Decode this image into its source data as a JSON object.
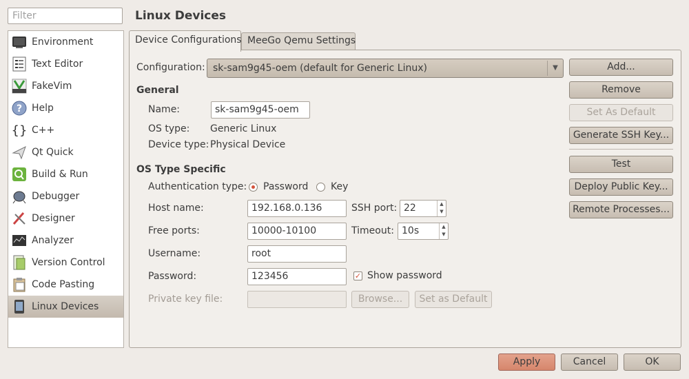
{
  "filter": {
    "placeholder": "Filter"
  },
  "sidebar": {
    "items": [
      {
        "label": "Environment",
        "icon": "monitor-icon"
      },
      {
        "label": "Text Editor",
        "icon": "text-editor-icon"
      },
      {
        "label": "FakeVim",
        "icon": "fakevim-icon"
      },
      {
        "label": "Help",
        "icon": "help-icon"
      },
      {
        "label": "C++",
        "icon": "braces-icon"
      },
      {
        "label": "Qt Quick",
        "icon": "qt-quick-icon"
      },
      {
        "label": "Build & Run",
        "icon": "build-run-icon"
      },
      {
        "label": "Debugger",
        "icon": "debugger-icon"
      },
      {
        "label": "Designer",
        "icon": "designer-icon"
      },
      {
        "label": "Analyzer",
        "icon": "analyzer-icon"
      },
      {
        "label": "Version Control",
        "icon": "version-control-icon"
      },
      {
        "label": "Code Pasting",
        "icon": "code-pasting-icon"
      },
      {
        "label": "Linux Devices",
        "icon": "linux-device-icon",
        "selected": true
      }
    ]
  },
  "page_title": "Linux Devices",
  "tabs": [
    {
      "label": "Device Configurations",
      "active": true
    },
    {
      "label": "MeeGo Qemu Settings",
      "active": false
    }
  ],
  "config": {
    "label": "Configuration:",
    "value": "sk-sam9g45-oem (default for Generic Linux)"
  },
  "general": {
    "title": "General",
    "name_label": "Name:",
    "name_value": "sk-sam9g45-oem",
    "os_type_label": "OS type:",
    "os_type_value": "Generic Linux",
    "device_type_label": "Device type:",
    "device_type_value": "Physical Device"
  },
  "os_specific": {
    "title": "OS Type Specific",
    "auth_label": "Authentication type:",
    "auth_password": "Password",
    "auth_key": "Key",
    "auth_selected": "Password",
    "host_label": "Host name:",
    "host_value": "192.168.0.136",
    "ssh_port_label": "SSH port:",
    "ssh_port_value": "22",
    "free_ports_label": "Free ports:",
    "free_ports_value": "10000-10100",
    "timeout_label": "Timeout:",
    "timeout_value": "10s",
    "username_label": "Username:",
    "username_value": "root",
    "password_label": "Password:",
    "password_value": "123456",
    "show_password_label": "Show password",
    "show_password_checked": true,
    "private_key_label": "Private key file:",
    "private_key_value": "",
    "browse_label": "Browse...",
    "set_default_label": "Set as Default"
  },
  "side_buttons": {
    "add": "Add...",
    "remove": "Remove",
    "set_as_default": "Set As Default",
    "generate_ssh_key": "Generate SSH Key...",
    "test": "Test",
    "deploy_public_key": "Deploy Public Key...",
    "remote_processes": "Remote Processes..."
  },
  "footer": {
    "apply": "Apply",
    "cancel": "Cancel",
    "ok": "OK"
  },
  "colors": {
    "window_bg": "#efebe7",
    "selection": "#c9c0b5",
    "accent": "#d4533b"
  }
}
